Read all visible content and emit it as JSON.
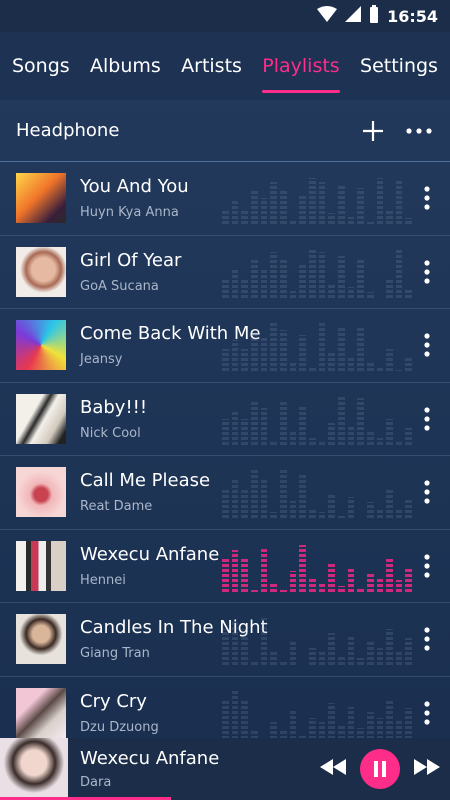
{
  "status": {
    "time": "16:54"
  },
  "tabs": [
    {
      "label": "Songs"
    },
    {
      "label": "Albums"
    },
    {
      "label": "Artists"
    },
    {
      "label": "Playlists"
    },
    {
      "label": "Settings"
    }
  ],
  "active_tab": "Playlists",
  "header": {
    "title": "Headphone"
  },
  "songs": [
    {
      "title": "You And You",
      "artist": "Huyn Kya Anna"
    },
    {
      "title": "Girl Of Year",
      "artist": "GoA Sucana"
    },
    {
      "title": "Come Back With Me",
      "artist": "Jeansy"
    },
    {
      "title": "Baby!!!",
      "artist": "Nick Cool"
    },
    {
      "title": "Call Me Please",
      "artist": "Reat Dame"
    },
    {
      "title": "Wexecu Anfane",
      "artist": "Hennei"
    },
    {
      "title": "Candles In The Night",
      "artist": "Giang Tran"
    },
    {
      "title": "Cry Cry",
      "artist": "Dzu Dzuong"
    }
  ],
  "now_playing": {
    "title": "Wexecu Anfane",
    "artist": "Dara",
    "progress_fraction": 0.38
  },
  "colors": {
    "accent": "#ff2d8a",
    "background": "#1f3658"
  }
}
